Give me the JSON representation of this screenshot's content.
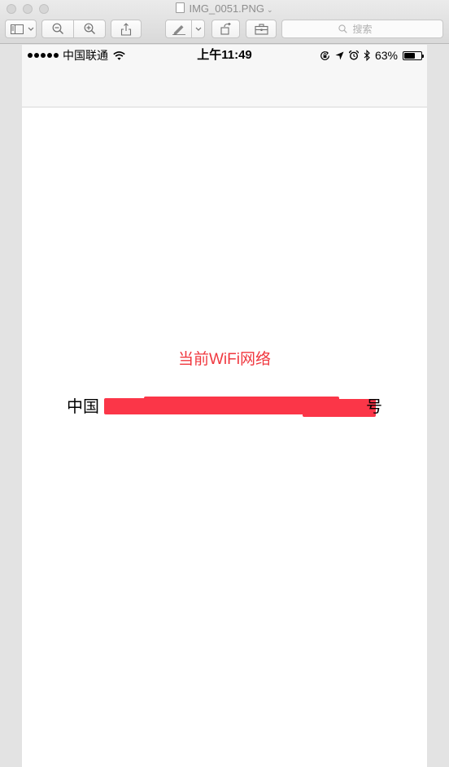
{
  "window": {
    "title": "IMG_0051.PNG",
    "search_placeholder": "搜索"
  },
  "toolbar": {
    "buttons": [
      {
        "name": "sidebar-toggle"
      },
      {
        "name": "zoom-out"
      },
      {
        "name": "zoom-in"
      },
      {
        "name": "share"
      },
      {
        "name": "markup"
      },
      {
        "name": "rotate"
      },
      {
        "name": "toolbox"
      }
    ]
  },
  "status_bar": {
    "carrier": "中国联通",
    "time": "上午11:49",
    "battery_percent": "63%",
    "battery_level": 0.63,
    "icons": [
      "signal-dots-icon",
      "wifi-icon",
      "orientation-lock-icon",
      "location-arrow-icon",
      "alarm-icon",
      "bluetooth-icon",
      "battery-icon"
    ]
  },
  "content": {
    "heading": "当前WiFi网络",
    "network_prefix": "中国",
    "network_suffix": "号"
  },
  "colors": {
    "accent_red": "#f0383f",
    "redaction": "#fb3648"
  }
}
